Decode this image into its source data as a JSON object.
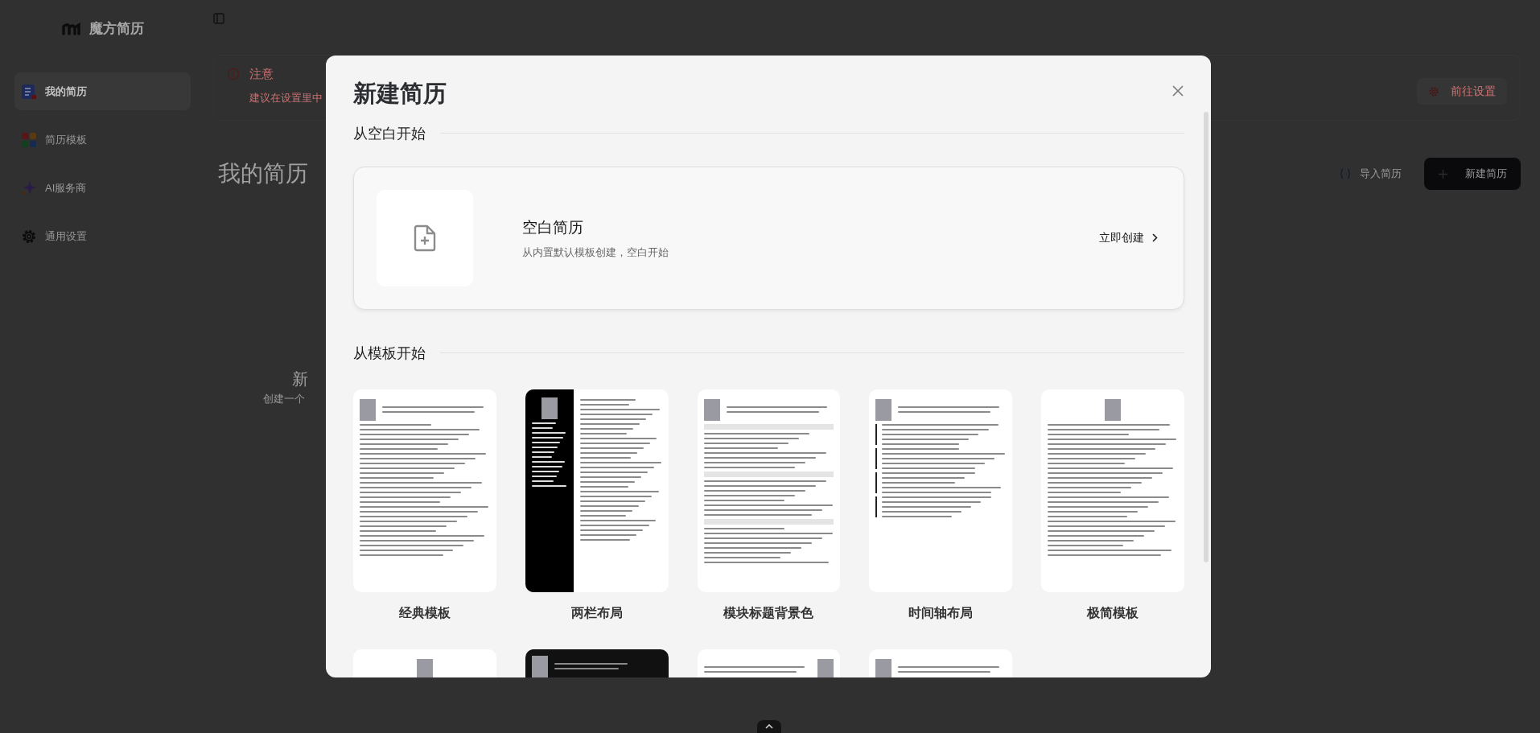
{
  "app": {
    "logo_text": "魔方简历"
  },
  "sidebar": {
    "items": [
      {
        "label": "我的简历",
        "selected": true
      },
      {
        "label": "简历模板",
        "selected": false
      },
      {
        "label": "AI服务商",
        "selected": false
      },
      {
        "label": "通用设置",
        "selected": false
      }
    ]
  },
  "alert": {
    "title": "注意",
    "message": "建议在设置里中",
    "action": "前往设置"
  },
  "page": {
    "title": "我的简历",
    "import_button": "导入简历",
    "new_button": "新建简历",
    "empty_title": "新",
    "empty_text": "创建一个"
  },
  "modal": {
    "title": "新建简历",
    "blank_section": "从空白开始",
    "blank_card": {
      "title": "空白简历",
      "description": "从内置默认模板创建，空白开始",
      "action": "立即创建"
    },
    "template_section": "从模板开始",
    "templates": [
      {
        "name": "经典模板",
        "kind": "classic"
      },
      {
        "name": "两栏布局",
        "kind": "sidebar"
      },
      {
        "name": "模块标题背景色",
        "kind": "bands"
      },
      {
        "name": "时间轴布局",
        "kind": "timeline"
      },
      {
        "name": "极简模板",
        "kind": "centered"
      },
      {
        "kind": "centered"
      },
      {
        "kind": "banner"
      },
      {
        "kind": "mirrored"
      },
      {
        "kind": "classic"
      }
    ]
  }
}
